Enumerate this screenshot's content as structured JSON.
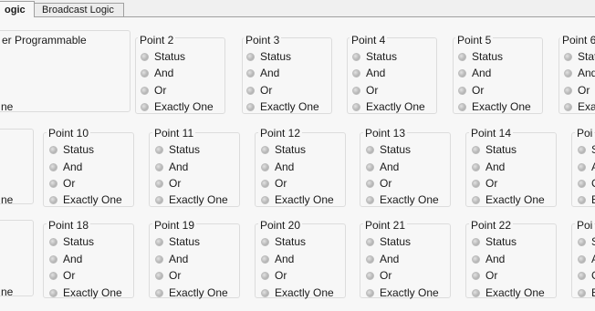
{
  "tabs": [
    {
      "label": "ogic",
      "active": true
    },
    {
      "label": "Broadcast Logic",
      "active": false
    }
  ],
  "left_group": {
    "title": "er Programmable"
  },
  "row_tail_text": [
    "ne",
    "ne",
    "ne"
  ],
  "options": [
    "Status",
    "And",
    "Or",
    "Exactly One"
  ],
  "rows": [
    {
      "points": [
        "Point 2",
        "Point 3",
        "Point 4",
        "Point 5",
        "Point 6"
      ]
    },
    {
      "points": [
        "Point 10",
        "Point 11",
        "Point 12",
        "Point 13",
        "Point 14",
        "Poi"
      ]
    },
    {
      "points": [
        "Point 18",
        "Point 19",
        "Point 20",
        "Point 21",
        "Point 22",
        "Poi"
      ]
    }
  ],
  "clipped_right_col": {
    "row1": [
      "Stat",
      "And",
      "Or",
      "Exa"
    ],
    "row2": [
      "S",
      "A",
      "C",
      "E"
    ],
    "row3": [
      "S",
      "A",
      "C",
      "E"
    ]
  }
}
